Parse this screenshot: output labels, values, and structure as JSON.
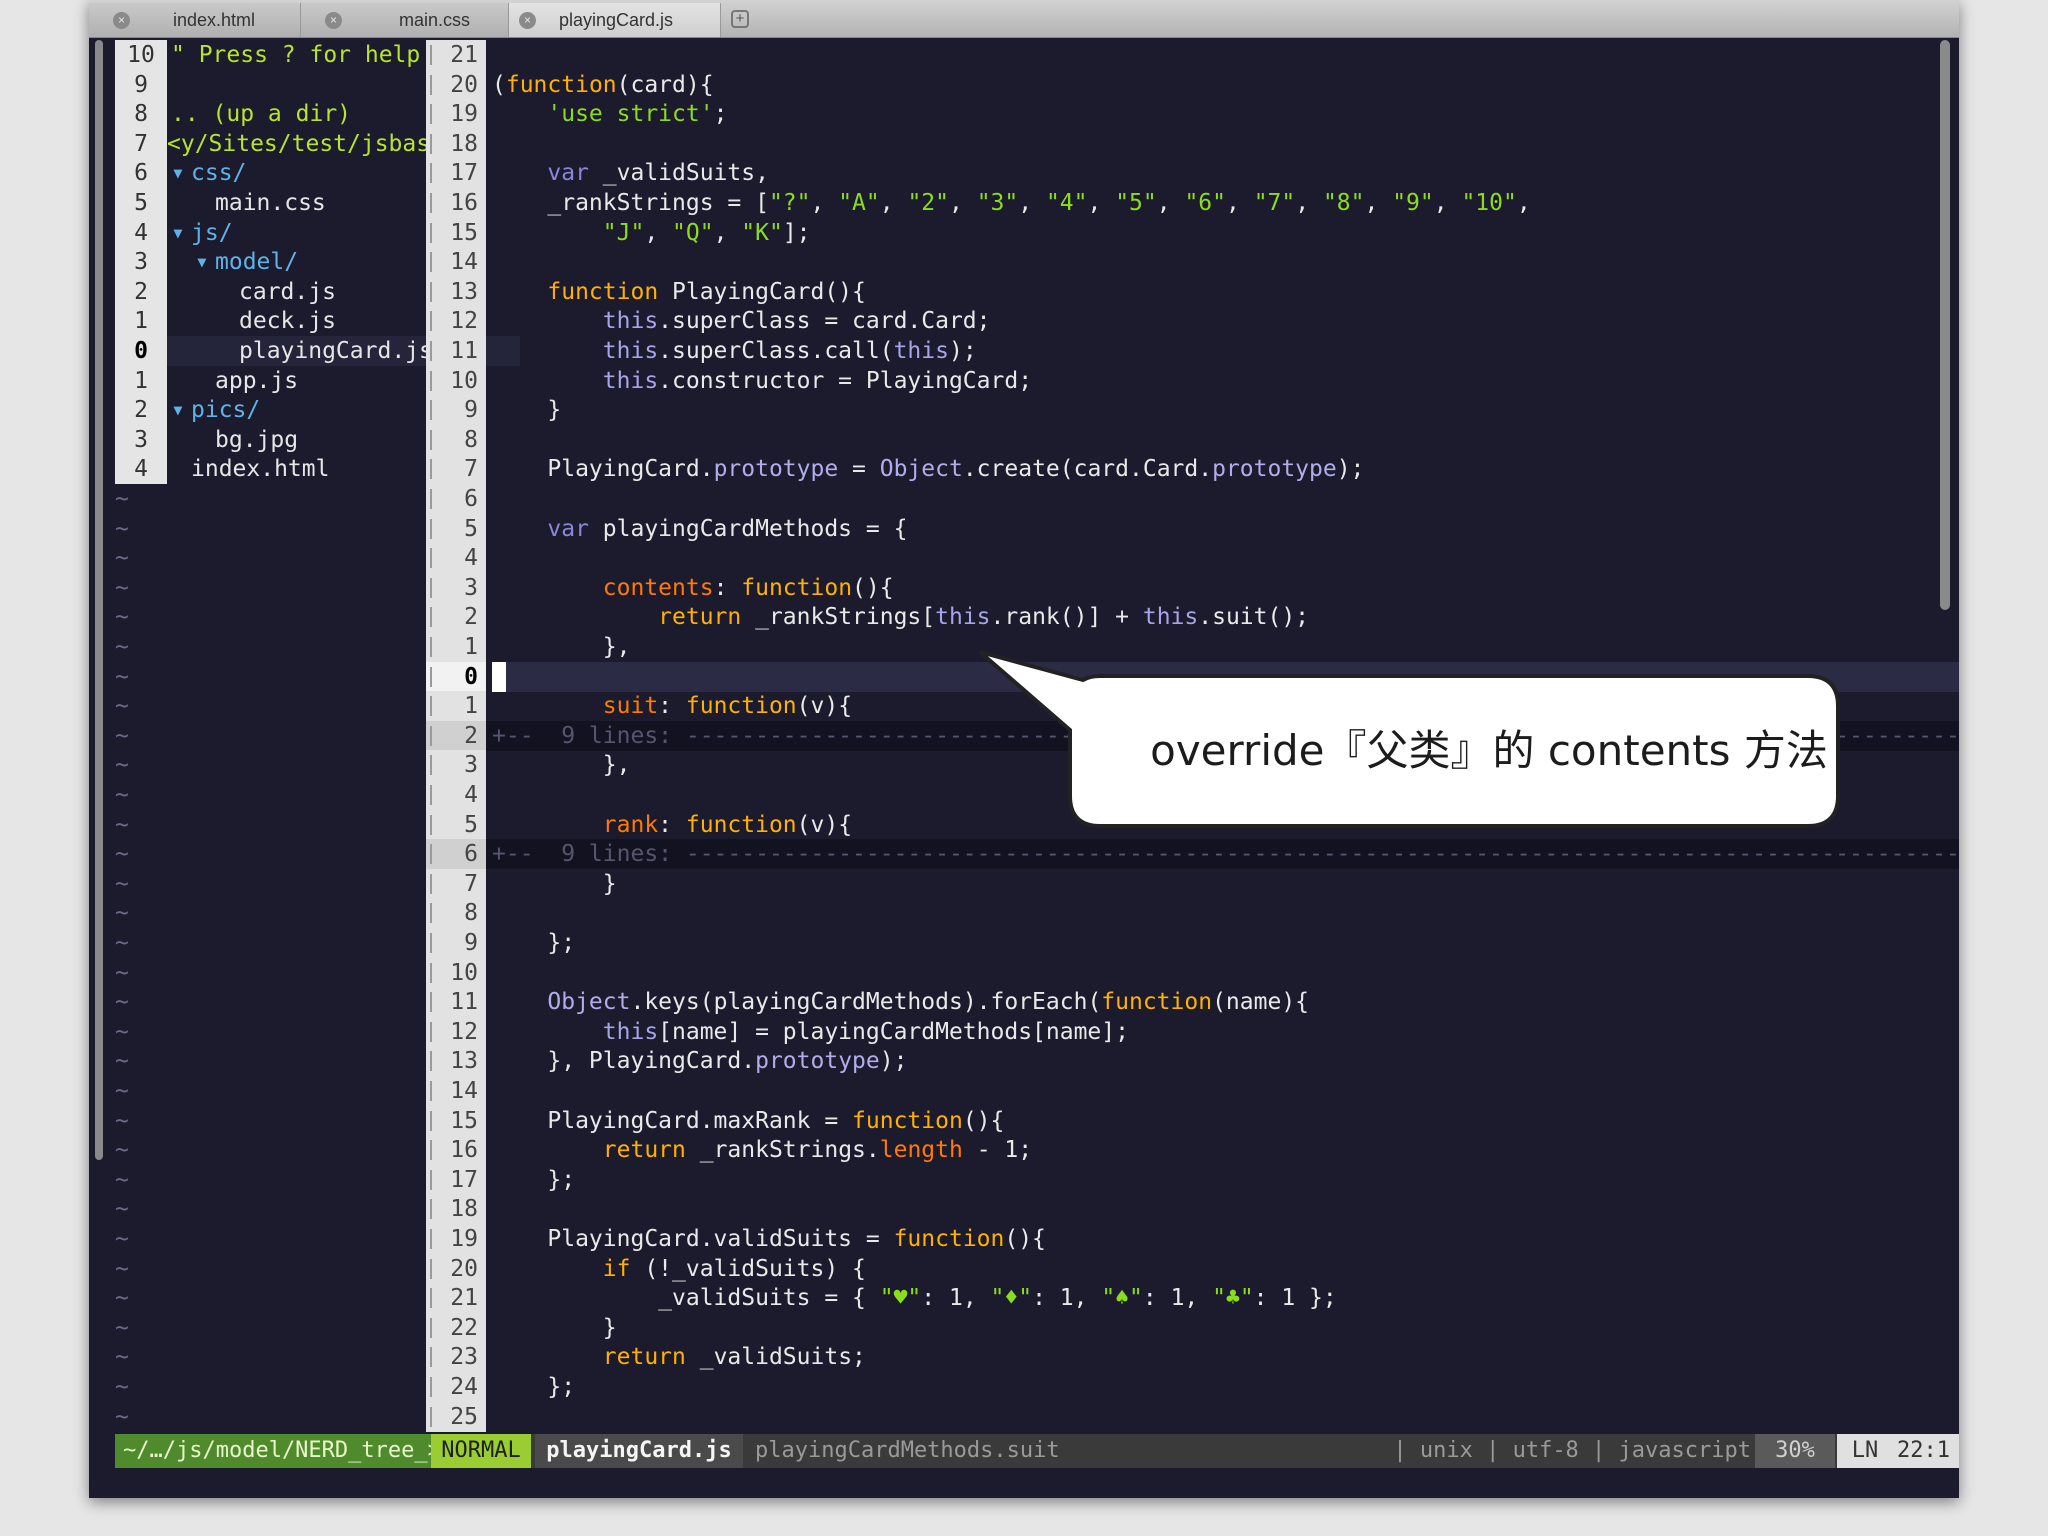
{
  "tabs": [
    {
      "label": "index.html",
      "active": false
    },
    {
      "label": "main.css",
      "active": false
    },
    {
      "label": "playingCard.js",
      "active": true
    }
  ],
  "tab_close_glyph": "×",
  "tab_add_glyph": "+",
  "nerdtree": {
    "rows": [
      {
        "num": "10",
        "text": "\" Press ? for help",
        "kind": "help"
      },
      {
        "num": "9",
        "text": "",
        "kind": "blank"
      },
      {
        "num": "8",
        "text": ".. (up a dir)",
        "kind": "help"
      },
      {
        "num": "7",
        "text": "<y/Sites/test/jsbasic",
        "kind": "root"
      },
      {
        "num": "6",
        "arrow": "▾",
        "text": "css/",
        "indent": 0,
        "kind": "dir"
      },
      {
        "num": "5",
        "text": "main.css",
        "indent": 1,
        "kind": "file"
      },
      {
        "num": "4",
        "arrow": "▾",
        "text": "js/",
        "indent": 0,
        "kind": "dir"
      },
      {
        "num": "3",
        "arrow": "▾",
        "text": "model/",
        "indent": 1,
        "kind": "dir"
      },
      {
        "num": "2",
        "text": "card.js",
        "indent": 2,
        "kind": "file"
      },
      {
        "num": "1",
        "text": "deck.js",
        "indent": 2,
        "kind": "file"
      },
      {
        "num": "0",
        "text": "playingCard.js",
        "indent": 2,
        "kind": "file",
        "current": true
      },
      {
        "num": "1",
        "text": "app.js",
        "indent": 1,
        "kind": "file"
      },
      {
        "num": "2",
        "arrow": "▾",
        "text": "pics/",
        "indent": 0,
        "kind": "dir"
      },
      {
        "num": "3",
        "text": "bg.jpg",
        "indent": 1,
        "kind": "file"
      },
      {
        "num": "4",
        "text": "index.html",
        "indent": 0,
        "kind": "file"
      }
    ],
    "tilde": "~"
  },
  "editor": {
    "lines": [
      {
        "n": "21",
        "tokens": []
      },
      {
        "n": "20",
        "tokens": [
          [
            "g",
            "("
          ],
          [
            "k",
            "function"
          ],
          [
            "g",
            "(card){"
          ]
        ]
      },
      {
        "n": "19",
        "tokens": [
          [
            "g",
            "    "
          ],
          [
            "s",
            "'use strict'"
          ],
          [
            "g",
            ";"
          ]
        ]
      },
      {
        "n": "18",
        "tokens": []
      },
      {
        "n": "17",
        "tokens": [
          [
            "g",
            "    "
          ],
          [
            "kv",
            "var"
          ],
          [
            "g",
            " _validSuits,"
          ]
        ]
      },
      {
        "n": "16",
        "tokens": [
          [
            "g",
            "    _rankStrings = ["
          ],
          [
            "s",
            "\"?\""
          ],
          [
            "g",
            ", "
          ],
          [
            "s",
            "\"A\""
          ],
          [
            "g",
            ", "
          ],
          [
            "s",
            "\"2\""
          ],
          [
            "g",
            ", "
          ],
          [
            "s",
            "\"3\""
          ],
          [
            "g",
            ", "
          ],
          [
            "s",
            "\"4\""
          ],
          [
            "g",
            ", "
          ],
          [
            "s",
            "\"5\""
          ],
          [
            "g",
            ", "
          ],
          [
            "s",
            "\"6\""
          ],
          [
            "g",
            ", "
          ],
          [
            "s",
            "\"7\""
          ],
          [
            "g",
            ", "
          ],
          [
            "s",
            "\"8\""
          ],
          [
            "g",
            ", "
          ],
          [
            "s",
            "\"9\""
          ],
          [
            "g",
            ", "
          ],
          [
            "s",
            "\"10\""
          ],
          [
            "g",
            ","
          ]
        ]
      },
      {
        "n": "15",
        "tokens": [
          [
            "g",
            "        "
          ],
          [
            "s",
            "\"J\""
          ],
          [
            "g",
            ", "
          ],
          [
            "s",
            "\"Q\""
          ],
          [
            "g",
            ", "
          ],
          [
            "s",
            "\"K\""
          ],
          [
            "g",
            "];"
          ]
        ]
      },
      {
        "n": "14",
        "tokens": []
      },
      {
        "n": "13",
        "tokens": [
          [
            "g",
            "    "
          ],
          [
            "k",
            "function"
          ],
          [
            "g",
            " PlayingCard(){"
          ]
        ]
      },
      {
        "n": "12",
        "tokens": [
          [
            "g",
            "        "
          ],
          [
            "t",
            "this"
          ],
          [
            "g",
            ".superClass = card.Card;"
          ]
        ]
      },
      {
        "n": "11",
        "tokens": [
          [
            "g",
            "        "
          ],
          [
            "t",
            "this"
          ],
          [
            "g",
            ".superClass.call("
          ],
          [
            "t",
            "this"
          ],
          [
            "g",
            ");"
          ]
        ]
      },
      {
        "n": "10",
        "tokens": [
          [
            "g",
            "        "
          ],
          [
            "t",
            "this"
          ],
          [
            "g",
            ".constructor = PlayingCard;"
          ]
        ]
      },
      {
        "n": "9",
        "tokens": [
          [
            "g",
            "    }"
          ]
        ]
      },
      {
        "n": "8",
        "tokens": []
      },
      {
        "n": "7",
        "tokens": [
          [
            "g",
            "    PlayingCard."
          ],
          [
            "o",
            "prototype"
          ],
          [
            "g",
            " = "
          ],
          [
            "o",
            "Object"
          ],
          [
            "g",
            ".create(card.Card."
          ],
          [
            "o",
            "prototype"
          ],
          [
            "g",
            ");"
          ]
        ]
      },
      {
        "n": "6",
        "tokens": []
      },
      {
        "n": "5",
        "tokens": [
          [
            "g",
            "    "
          ],
          [
            "kv",
            "var"
          ],
          [
            "g",
            " playingCardMethods = {"
          ]
        ]
      },
      {
        "n": "4",
        "tokens": []
      },
      {
        "n": "3",
        "tokens": [
          [
            "g",
            "        "
          ],
          [
            "p",
            "contents"
          ],
          [
            "g",
            ": "
          ],
          [
            "k",
            "function"
          ],
          [
            "g",
            "(){"
          ]
        ]
      },
      {
        "n": "2",
        "tokens": [
          [
            "g",
            "            "
          ],
          [
            "k",
            "return"
          ],
          [
            "g",
            " _rankStrings["
          ],
          [
            "t",
            "this"
          ],
          [
            "g",
            ".rank()] + "
          ],
          [
            "t",
            "this"
          ],
          [
            "g",
            ".suit();"
          ]
        ]
      },
      {
        "n": "1",
        "tokens": [
          [
            "g",
            "        },"
          ]
        ]
      },
      {
        "n": "0",
        "tokens": [],
        "current": true
      },
      {
        "n": "1",
        "tokens": [
          [
            "g",
            "        "
          ],
          [
            "p",
            "suit"
          ],
          [
            "g",
            ": "
          ],
          [
            "k",
            "function"
          ],
          [
            "g",
            "(v){"
          ]
        ]
      },
      {
        "n": "2",
        "fold": "+--  9 lines: ----------------------------------------------------------------------------------------------------------------------------------------------------"
      },
      {
        "n": "3",
        "tokens": [
          [
            "g",
            "        },"
          ]
        ]
      },
      {
        "n": "4",
        "tokens": []
      },
      {
        "n": "5",
        "tokens": [
          [
            "g",
            "        "
          ],
          [
            "p",
            "rank"
          ],
          [
            "g",
            ": "
          ],
          [
            "k",
            "function"
          ],
          [
            "g",
            "(v){"
          ]
        ]
      },
      {
        "n": "6",
        "fold": "+--  9 lines: ----------------------------------------------------------------------------------------------------------------------------------------------------"
      },
      {
        "n": "7",
        "tokens": [
          [
            "g",
            "        }"
          ]
        ]
      },
      {
        "n": "8",
        "tokens": []
      },
      {
        "n": "9",
        "tokens": [
          [
            "g",
            "    };"
          ]
        ]
      },
      {
        "n": "10",
        "tokens": []
      },
      {
        "n": "11",
        "tokens": [
          [
            "g",
            "    "
          ],
          [
            "o",
            "Object"
          ],
          [
            "g",
            ".keys(playingCardMethods).forEach("
          ],
          [
            "k",
            "function"
          ],
          [
            "g",
            "(name){"
          ]
        ]
      },
      {
        "n": "12",
        "tokens": [
          [
            "g",
            "        "
          ],
          [
            "t",
            "this"
          ],
          [
            "g",
            "[name] = playingCardMethods[name];"
          ]
        ]
      },
      {
        "n": "13",
        "tokens": [
          [
            "g",
            "    }, PlayingCard."
          ],
          [
            "o",
            "prototype"
          ],
          [
            "g",
            ");"
          ]
        ]
      },
      {
        "n": "14",
        "tokens": []
      },
      {
        "n": "15",
        "tokens": [
          [
            "g",
            "    PlayingCard.maxRank = "
          ],
          [
            "k",
            "function"
          ],
          [
            "g",
            "(){"
          ]
        ]
      },
      {
        "n": "16",
        "tokens": [
          [
            "g",
            "        "
          ],
          [
            "k",
            "return"
          ],
          [
            "g",
            " _rankStrings."
          ],
          [
            "p",
            "length"
          ],
          [
            "g",
            " - 1;"
          ]
        ]
      },
      {
        "n": "17",
        "tokens": [
          [
            "g",
            "    };"
          ]
        ]
      },
      {
        "n": "18",
        "tokens": []
      },
      {
        "n": "19",
        "tokens": [
          [
            "g",
            "    PlayingCard.validSuits = "
          ],
          [
            "k",
            "function"
          ],
          [
            "g",
            "(){"
          ]
        ]
      },
      {
        "n": "20",
        "tokens": [
          [
            "g",
            "        "
          ],
          [
            "k",
            "if"
          ],
          [
            "g",
            " (!_validSuits) {"
          ]
        ]
      },
      {
        "n": "21",
        "tokens": [
          [
            "g",
            "            _validSuits = { "
          ],
          [
            "s",
            "\"♥\""
          ],
          [
            "g",
            ": 1, "
          ],
          [
            "s",
            "\"♦\""
          ],
          [
            "g",
            ": 1, "
          ],
          [
            "s",
            "\"♠\""
          ],
          [
            "g",
            ": 1, "
          ],
          [
            "s",
            "\"♣\""
          ],
          [
            "g",
            ": 1 };"
          ]
        ]
      },
      {
        "n": "22",
        "tokens": [
          [
            "g",
            "        }"
          ]
        ]
      },
      {
        "n": "23",
        "tokens": [
          [
            "g",
            "        "
          ],
          [
            "k",
            "return"
          ],
          [
            "g",
            " _validSuits;"
          ]
        ]
      },
      {
        "n": "24",
        "tokens": [
          [
            "g",
            "    };"
          ]
        ]
      },
      {
        "n": "25",
        "tokens": []
      }
    ]
  },
  "statusbar": {
    "tree": "~/…/js/model/NERD_tree_>",
    "mode": "NORMAL",
    "file": "playingCard.js",
    "func": "playingCardMethods.suit",
    "format": "| unix | utf-8 | javascript",
    "percent": "30%",
    "ln_label": "LN",
    "position": "22:1"
  },
  "callout": {
    "text": "override『父类』的 contents 方法"
  },
  "colors": {
    "background": "#1b1b2d",
    "keyword": "#ffb000",
    "string": "#8bdd1b",
    "this": "#a7a4e8",
    "property": "#ff7a00",
    "mode_bg": "#9acd32"
  }
}
